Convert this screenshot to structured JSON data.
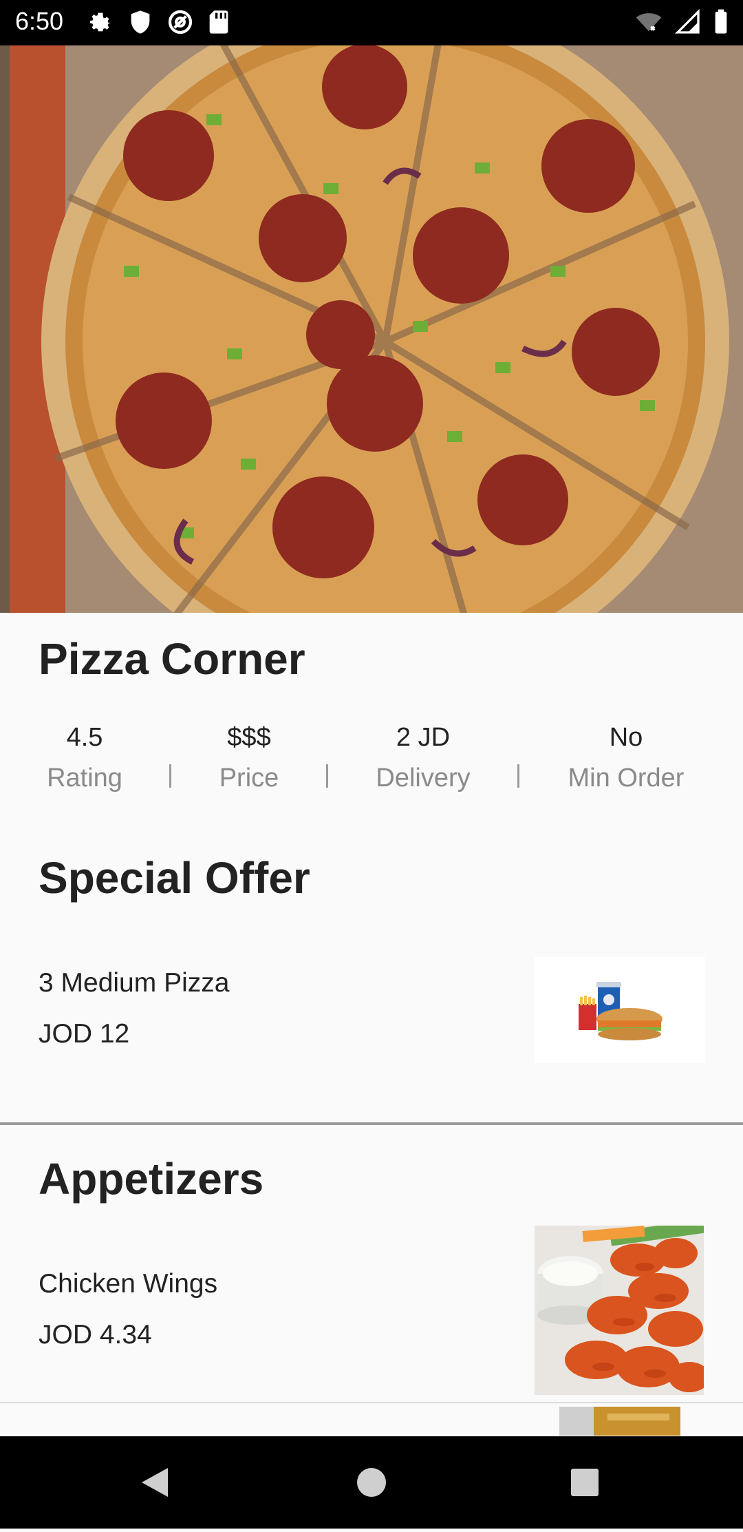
{
  "status_bar": {
    "time": "6:50",
    "left_icons": [
      "gear-icon",
      "shield-icon",
      "at-sign-icon",
      "sd-card-icon"
    ],
    "right_icons": [
      "wifi-icon",
      "signal-icon",
      "battery-icon"
    ]
  },
  "restaurant": {
    "name": "Pizza Corner",
    "hero_image": "pepperoni-pizza-photo",
    "stats": [
      {
        "value": "4.5",
        "label": "Rating"
      },
      {
        "value": "$$$",
        "label": "Price"
      },
      {
        "value": "2 JD",
        "label": "Delivery"
      },
      {
        "value": "No",
        "label": "Min Order"
      }
    ]
  },
  "special_offer": {
    "title": "Special Offer",
    "items": [
      {
        "name": "3 Medium Pizza",
        "price": "JOD 12",
        "image": "combo-meal-photo"
      }
    ]
  },
  "appetizers": {
    "title": "Appetizers",
    "items": [
      {
        "name": "Chicken Wings",
        "price": "JOD 4.34",
        "image": "chicken-wings-photo"
      }
    ]
  },
  "nav_bar": {
    "buttons": [
      "back-icon",
      "home-icon",
      "recents-icon"
    ]
  },
  "colors": {
    "background": "#fafafa",
    "text": "#222222",
    "muted": "#8a8a8a",
    "status_bar": "#000000"
  }
}
